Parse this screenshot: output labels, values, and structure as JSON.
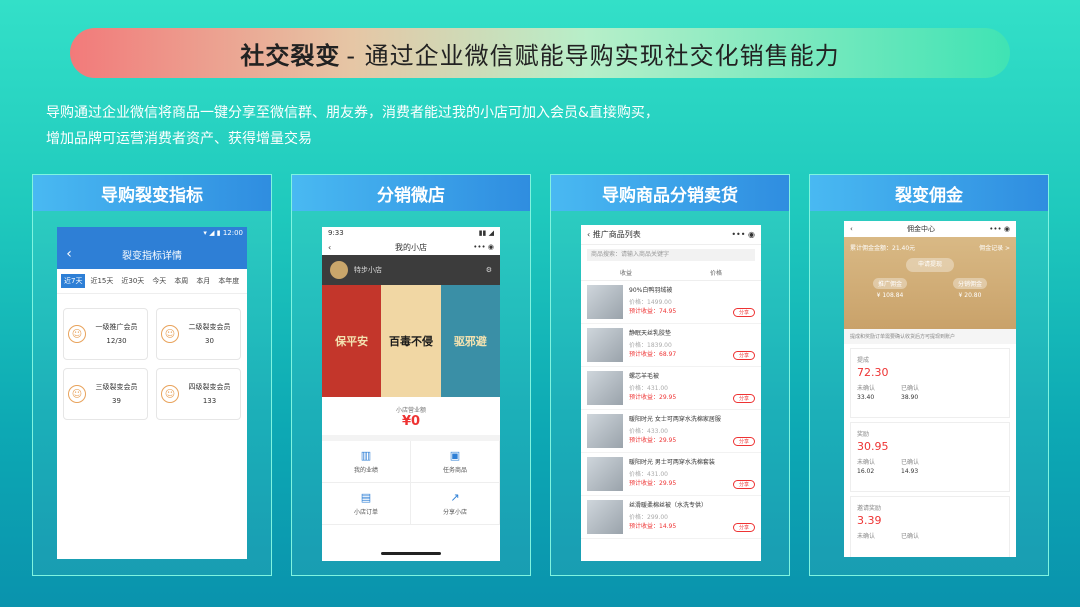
{
  "header": {
    "title_bold": "社交裂变",
    "title_rest": "- 通过企业微信赋能导购实现社交化销售能力"
  },
  "description": {
    "line1": "导购通过企业微信将商品一键分享至微信群、朋友券，消费者能过我的小店可加入会员&直接购买，",
    "line2": "增加品牌可运营消费者资产、获得增量交易"
  },
  "panels": [
    {
      "title": "导购裂变指标",
      "screen": {
        "status": "▾ ◢ ▮ 12:00",
        "nav_title": "裂变指标详情",
        "filters": [
          "近7天",
          "近15天",
          "近30天",
          "今天",
          "本周",
          "本月",
          "本年度"
        ],
        "cards": [
          {
            "label": "一级推广会员",
            "value": "12/30"
          },
          {
            "label": "二级裂变会员",
            "value": "30"
          },
          {
            "label": "三级裂变会员",
            "value": "39"
          },
          {
            "label": "四级裂变会员",
            "value": "133"
          }
        ]
      }
    },
    {
      "title": "分销微店",
      "screen": {
        "time": "9:33",
        "nav_title": "我的小店",
        "shop_name": "特步小店",
        "poster": [
          "保平安",
          "百毒不侵",
          "驱邪避"
        ],
        "sales_label": "小店营业额",
        "sales_value": "¥0",
        "grid": [
          "我的业绩",
          "任务商品",
          "小店订单",
          "分享小店"
        ]
      }
    },
    {
      "title": "导购商品分销卖货",
      "screen": {
        "nav_title": "推广商品列表",
        "search_placeholder": "商品搜索：请输入商品关键字",
        "tabs": [
          "收益",
          "价格"
        ],
        "items": [
          {
            "name": "90%白鸭羽绒被",
            "price": "价格：1499.00",
            "earn": "预计收益：74.95"
          },
          {
            "name": "静眠天丝乳胶垫",
            "price": "价格：1839.00",
            "earn": "预计收益：68.97"
          },
          {
            "name": "螺芯羊毛被",
            "price": "价格：431.00",
            "earn": "预计收益：29.95"
          },
          {
            "name": "暖阳时光 女士可两穿水洗棉家居服",
            "price": "价格：433.00",
            "earn": "预计收益：29.95"
          },
          {
            "name": "暖阳时光 男士可两穿水洗棉套装",
            "price": "价格：431.00",
            "earn": "预计收益：29.95"
          },
          {
            "name": "丝滑暖柔棉丝被（水洗专供）",
            "price": "价格：299.00",
            "earn": "预计收益：14.95"
          }
        ],
        "share_label": "分享"
      }
    },
    {
      "title": "裂变佣金",
      "screen": {
        "nav_title": "佣金中心",
        "balance": "累计佣金金额：21.40元",
        "record": "佣金记录 >",
        "withdraw": "申请提现",
        "chips": [
          {
            "label": "推广佣金",
            "value": "¥ 108.84"
          },
          {
            "label": "分销佣金",
            "value": "¥ 20.80"
          }
        ],
        "tip": "提成和奖励订单需要确认收货后方可提现到账户",
        "cards": [
          {
            "title": "提成",
            "amount": "72.30",
            "a_label": "未确认",
            "a_value": "33.40",
            "b_label": "已确认",
            "b_value": "38.90"
          },
          {
            "title": "奖励",
            "amount": "30.95",
            "a_label": "未确认",
            "a_value": "16.02",
            "b_label": "已确认",
            "b_value": "14.93"
          },
          {
            "title": "邀请奖励",
            "amount": "3.39",
            "a_label": "未确认",
            "a_value": "",
            "b_label": "已确认",
            "b_value": ""
          }
        ]
      }
    }
  ]
}
